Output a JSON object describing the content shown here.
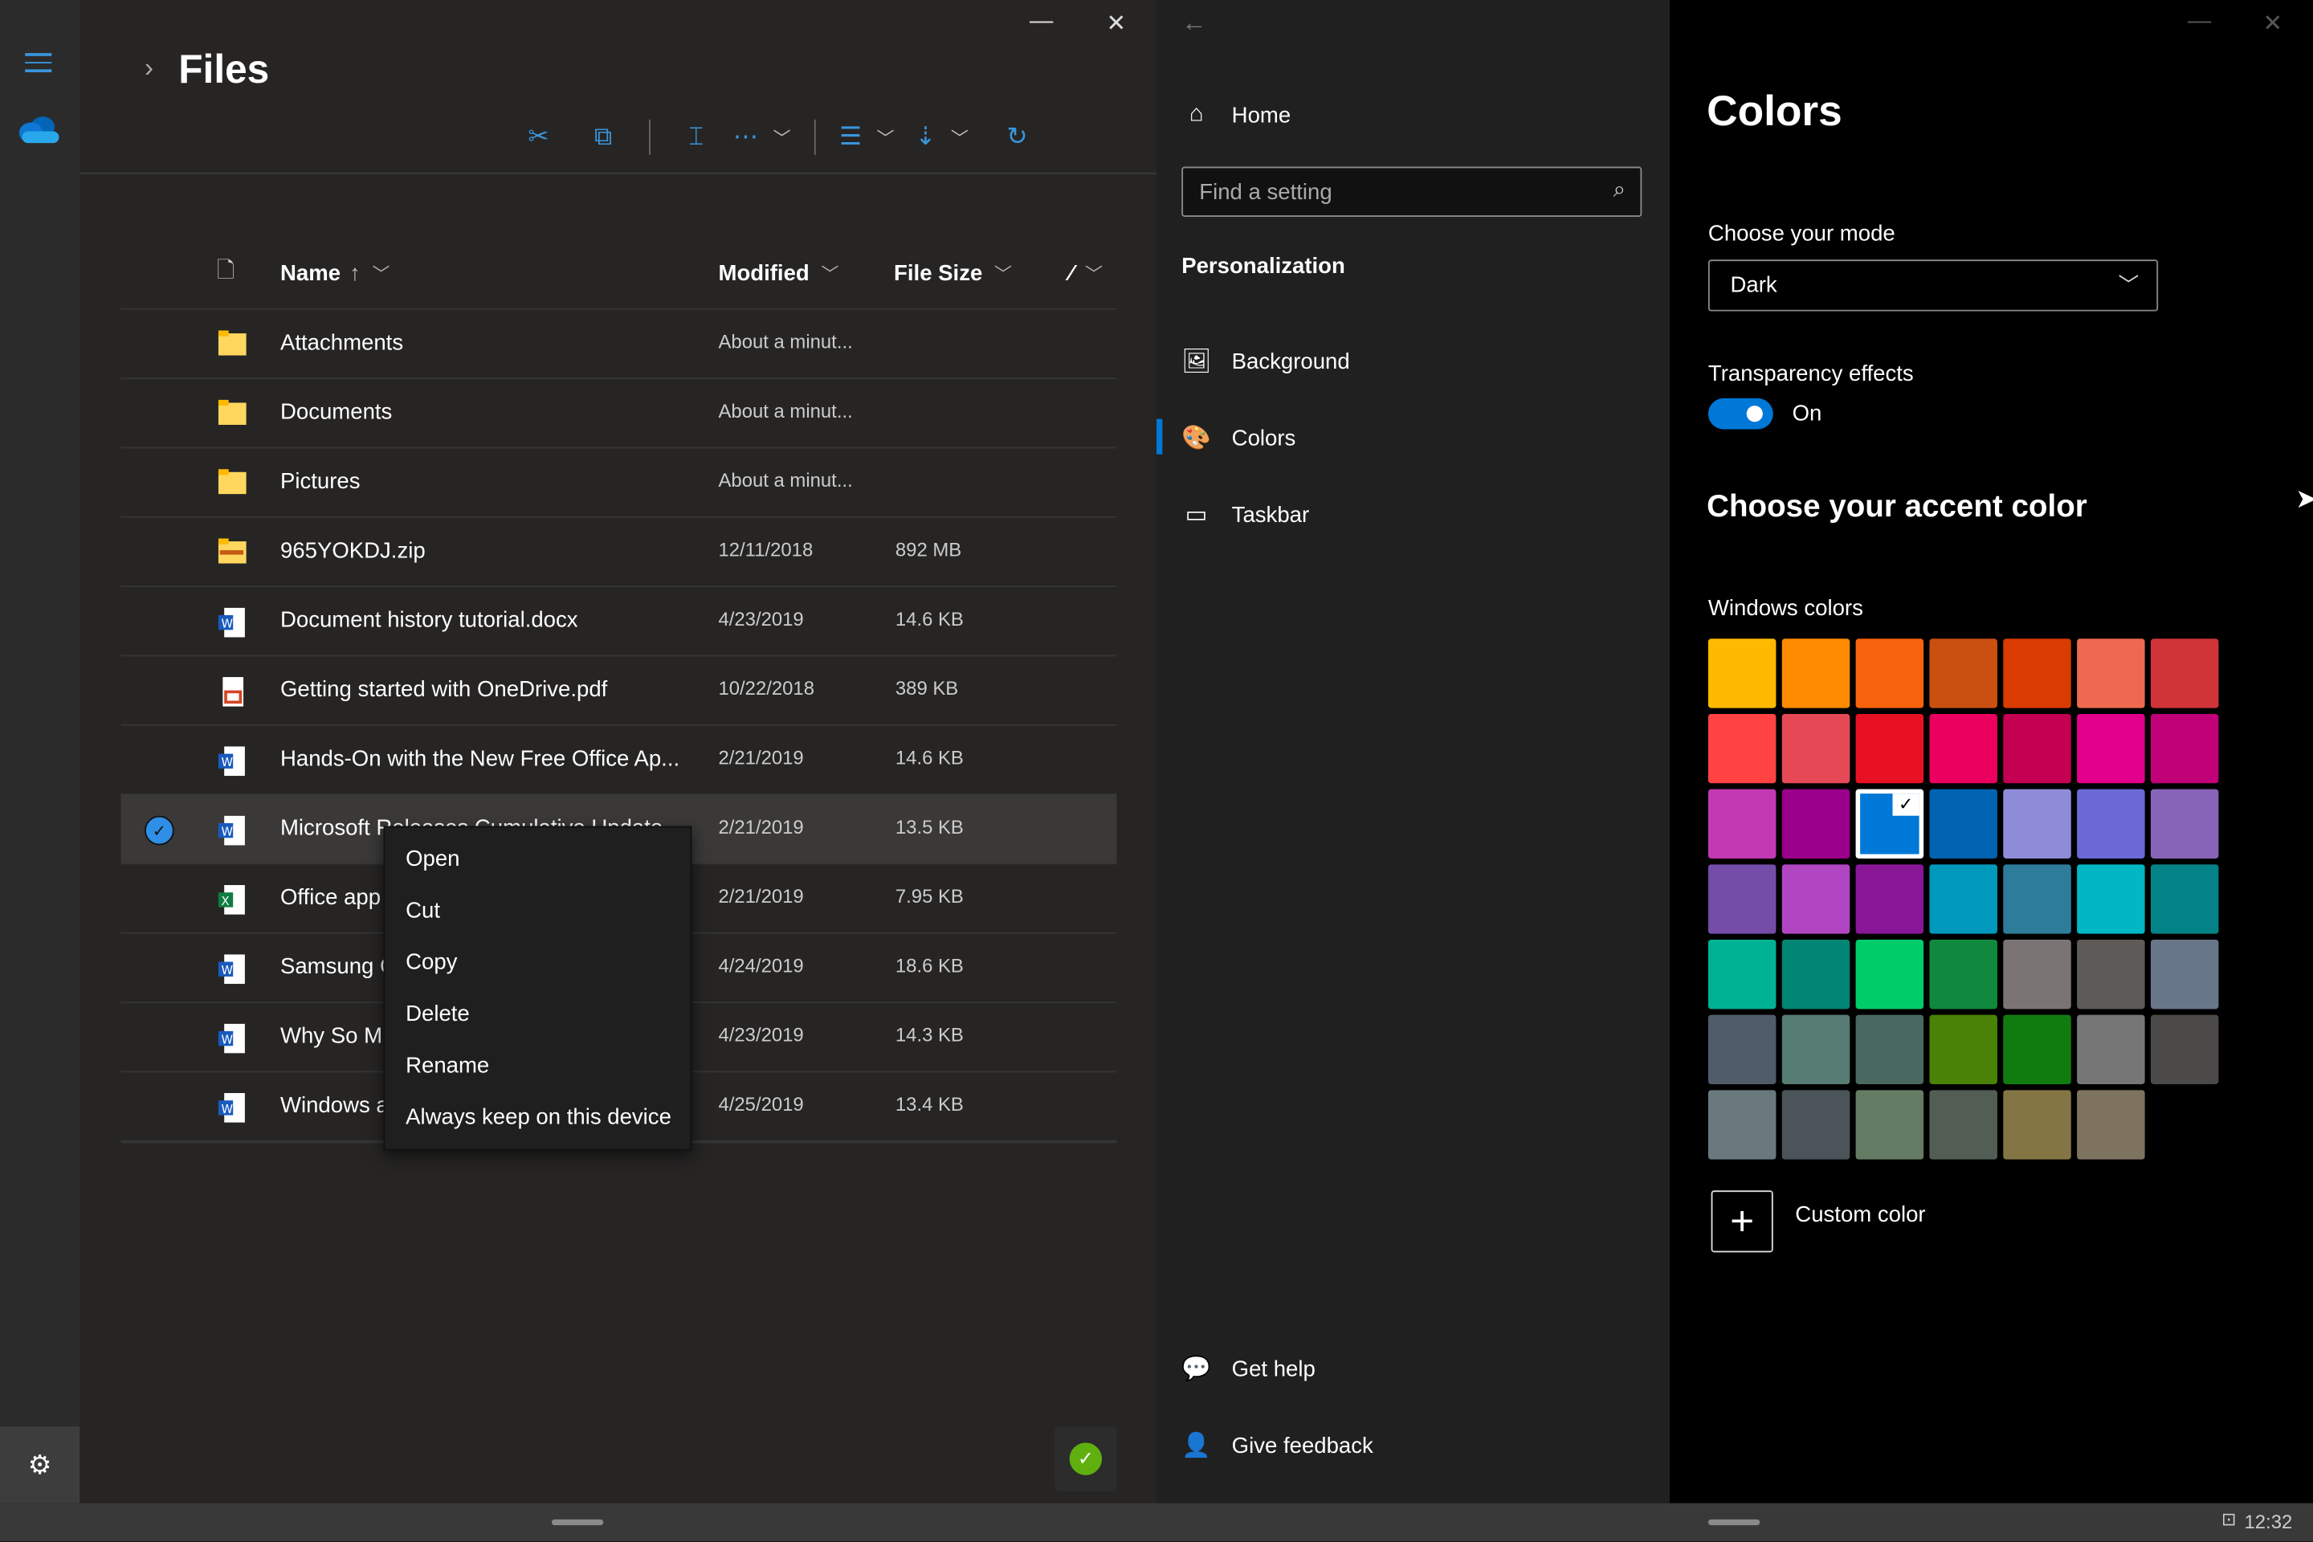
{
  "onedrive": {
    "title": "Files",
    "window_controls": {
      "minimize": "—",
      "close": "✕"
    },
    "toolbar": {
      "cut": "cut-icon",
      "copy": "copy-icon",
      "rename": "rename-icon",
      "more": "⋯",
      "view": "view-icon",
      "sort": "sort-icon",
      "refresh": "refresh-icon"
    },
    "columns": {
      "name": "Name",
      "name_sort": "↑",
      "modified": "Modified",
      "file_size": "File Size",
      "extra": "⁄"
    },
    "files": [
      {
        "name": "Attachments",
        "modified": "About a minut...",
        "size": "",
        "type": "folder"
      },
      {
        "name": "Documents",
        "modified": "About a minut...",
        "size": "",
        "type": "folder"
      },
      {
        "name": "Pictures",
        "modified": "About a minut...",
        "size": "",
        "type": "folder"
      },
      {
        "name": "965YOKDJ.zip",
        "modified": "12/11/2018",
        "size": "892 MB",
        "type": "zip"
      },
      {
        "name": "Document history tutorial.docx",
        "modified": "4/23/2019",
        "size": "14.6 KB",
        "type": "word"
      },
      {
        "name": "Getting started with OneDrive.pdf",
        "modified": "10/22/2018",
        "size": "389 KB",
        "type": "pdf"
      },
      {
        "name": "Hands-On with the New Free Office Ap...",
        "modified": "2/21/2019",
        "size": "14.6 KB",
        "type": "word"
      },
      {
        "name": "Microsoft Releases Cumulative Update...",
        "modified": "2/21/2019",
        "size": "13.5 KB",
        "type": "word",
        "selected": true
      },
      {
        "name": "Office app",
        "modified": "2/21/2019",
        "size": "7.95 KB",
        "type": "excel"
      },
      {
        "name": "Samsung G",
        "modified": "4/24/2019",
        "size": "18.6 KB",
        "type": "word"
      },
      {
        "name": "Why So M",
        "modified": "4/23/2019",
        "size": "14.3 KB",
        "type": "word"
      },
      {
        "name": "Windows a",
        "modified": "4/25/2019",
        "size": "13.4 KB",
        "type": "word"
      }
    ],
    "context_menu": [
      "Open",
      "Cut",
      "Copy",
      "Delete",
      "Rename",
      "Always keep on this device"
    ],
    "sync_status": "✓"
  },
  "settings_nav": {
    "back": "←",
    "home": "Home",
    "search_placeholder": "Find a setting",
    "section": "Personalization",
    "items": [
      {
        "label": "Background",
        "icon": "image-icon"
      },
      {
        "label": "Colors",
        "icon": "palette-icon",
        "active": true
      },
      {
        "label": "Taskbar",
        "icon": "taskbar-icon"
      }
    ],
    "get_help": "Get help",
    "give_feedback": "Give feedback"
  },
  "colors_page": {
    "title": "Colors",
    "window_controls": {
      "minimize": "—",
      "close": "✕"
    },
    "mode_label": "Choose your mode",
    "mode_value": "Dark",
    "transparency_label": "Transparency effects",
    "transparency_state": "On",
    "accent_heading": "Choose your accent color",
    "windows_colors_label": "Windows colors",
    "selected_color": "#0078D7",
    "swatches": [
      "#FFB900",
      "#FF8C00",
      "#F7630C",
      "#CA5010",
      "#DA3B01",
      "#EF6950",
      "#D13438",
      "#FF4343",
      "#E74856",
      "#E81123",
      "#EA005E",
      "#C30052",
      "#E3008C",
      "#BF0077",
      "#C239B3",
      "#9A0089",
      "#0078D7",
      "#0063B1",
      "#8E8CD8",
      "#6B69D6",
      "#8764B8",
      "#744DA9",
      "#B146C2",
      "#881798",
      "#0099BC",
      "#2D7D9A",
      "#00B7C3",
      "#038387",
      "#00B294",
      "#018574",
      "#00CC6A",
      "#10893E",
      "#7A7574",
      "#5D5A58",
      "#68768A",
      "#515C6B",
      "#567C73",
      "#486860",
      "#498205",
      "#107C10",
      "#767676",
      "#4C4A48",
      "#69797E",
      "#4A5459",
      "#647C64",
      "#525E54",
      "#847545",
      "#7E735F"
    ],
    "custom_color": "Custom color"
  },
  "taskbar": {
    "clock": "12:32"
  }
}
